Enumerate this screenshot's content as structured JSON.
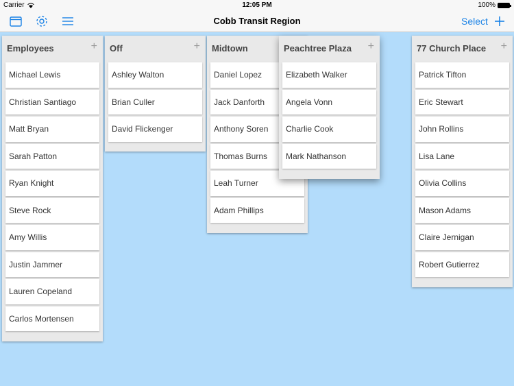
{
  "status": {
    "carrier": "Carrier",
    "time": "12:05 PM",
    "battery": "100%"
  },
  "nav": {
    "title": "Cobb Transit Region",
    "select_label": "Select",
    "add_icon": "plus-icon"
  },
  "columns": [
    {
      "title": "Employees",
      "cards": [
        "Michael Lewis",
        "Christian Santiago",
        "Matt Bryan",
        "Sarah Patton",
        "Ryan Knight",
        "Steve Rock",
        "Amy Willis",
        "Justin Jammer",
        "Lauren Copeland",
        "Carlos Mortensen"
      ]
    },
    {
      "title": "Off",
      "cards": [
        "Ashley Walton",
        "Brian Culler",
        "David Flickenger"
      ]
    },
    {
      "title": "Midtown",
      "cards": [
        "Daniel Lopez",
        "Jack Danforth",
        "Anthony Soren",
        "Thomas Burns",
        "Leah Turner",
        "Adam Phillips"
      ]
    },
    {
      "title": "Peachtree Plaza",
      "cards": [
        "Elizabeth Walker",
        "Angela Vonn",
        "Charlie Cook",
        "Mark Nathanson"
      ]
    },
    {
      "title": "77 Church Place",
      "cards": [
        "Patrick Tifton",
        "Eric Stewart",
        "John Rollins",
        "Lisa Lane",
        "Olivia Collins",
        "Mason Adams",
        "Claire Jernigan",
        "Robert Gutierrez"
      ]
    }
  ],
  "colors": {
    "accent": "#1a82e6",
    "background": "#b3dcfb",
    "column_bg": "#e9e9e9"
  }
}
